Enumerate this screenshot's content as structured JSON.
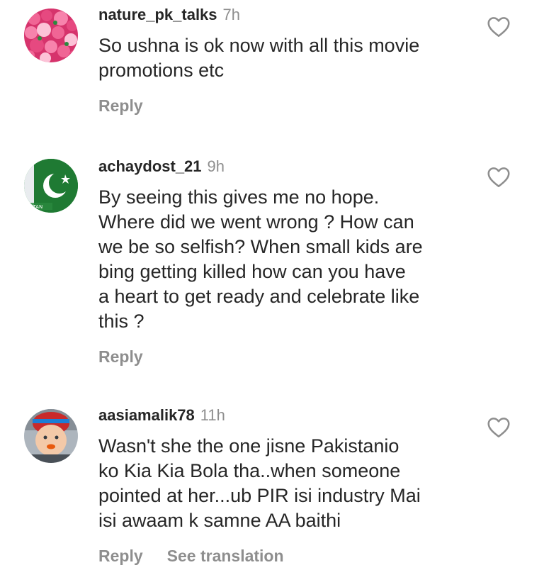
{
  "comments": [
    {
      "username": "nature_pk_talks",
      "time": "7h",
      "avatar_icon": "pink-roses-avatar",
      "lines": [
        "So ushna is ok now with all this movie",
        "promotions etc"
      ],
      "reply_label": "Reply"
    },
    {
      "username": "achaydost_21",
      "time": "9h",
      "avatar_icon": "pakistan-flag-avatar",
      "lines": [
        "By seeing this gives me no hope.",
        "Where did we went wrong ? How can",
        "we be so selfish? When small kids are",
        "bing getting killed how can you have",
        "a heart to get ready and celebrate like",
        "this ?"
      ],
      "reply_label": "Reply"
    },
    {
      "username": "aasiamalik78",
      "time": "11h",
      "avatar_icon": "child-photo-avatar",
      "lines": [
        "Wasn't she the one jisne Pakistanio",
        "ko Kia Kia Bola tha..when someone",
        "pointed at her...ub PIR isi industry Mai",
        "isi awaam k samne AA baithi"
      ],
      "reply_label": "Reply",
      "translate_label": "See translation"
    }
  ],
  "colors": {
    "text": "#262626",
    "secondary": "#8e8e8e",
    "heart_outline": "#8e8e8e"
  }
}
